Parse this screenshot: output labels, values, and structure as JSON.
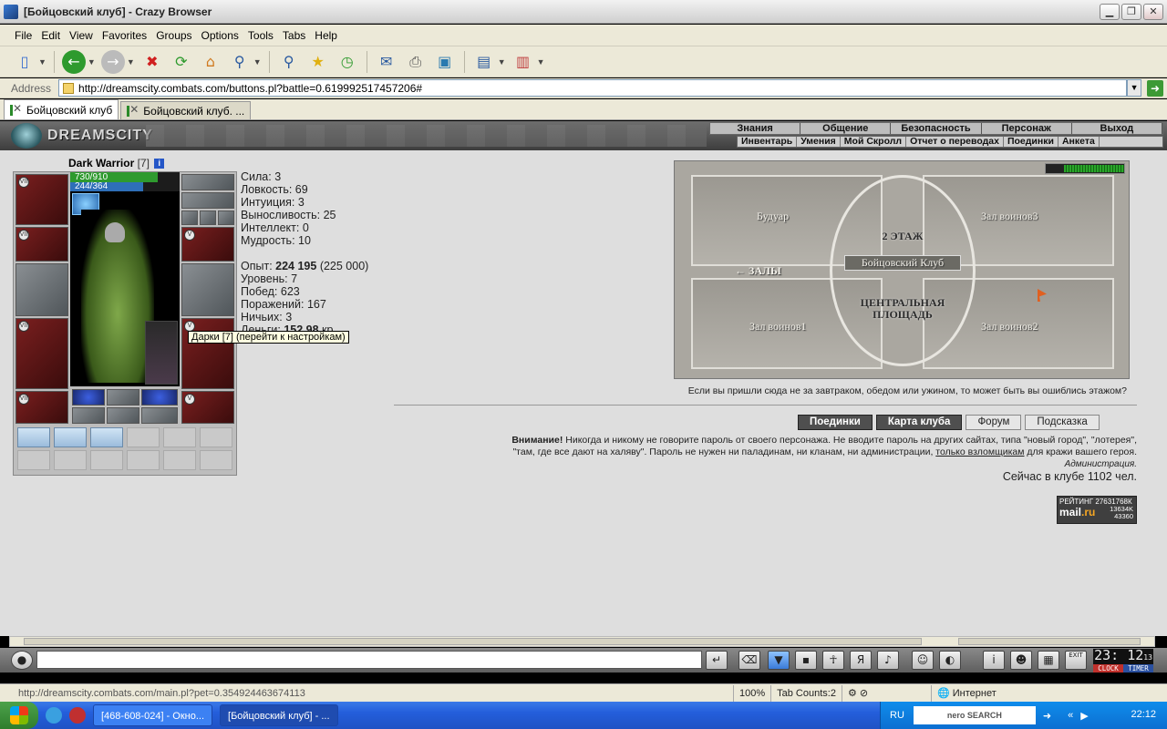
{
  "window": {
    "title": "[Бойцовский клуб] - Crazy Browser",
    "minimize": "▁",
    "maximize": "❐",
    "close": "✕"
  },
  "menu": [
    "File",
    "Edit",
    "View",
    "Favorites",
    "Groups",
    "Options",
    "Tools",
    "Tabs",
    "Help"
  ],
  "toolbar": {
    "icons": [
      "new-page-icon",
      "back-icon",
      "forward-icon",
      "stop-icon",
      "refresh-icon",
      "home-icon",
      "zoom-icon",
      "search-icon",
      "favorites-star-icon",
      "history-icon",
      "mail-icon",
      "print-icon",
      "edit-icon",
      "window-icon",
      "columns-icon"
    ]
  },
  "address": {
    "label": "Address",
    "url": "http://dreamscity.combats.com/buttons.pl?battle=0.619992517457206#"
  },
  "tabs": [
    {
      "label": "Бойцовский клуб",
      "active": true
    },
    {
      "label": "Бойцовский клуб. ...",
      "active": false
    }
  ],
  "game": {
    "logo": "DREAMSCITY",
    "top_nav": [
      "Знания",
      "Общение",
      "Безопасность",
      "Персонаж",
      "Выход"
    ],
    "sub_nav": [
      "Инвентарь",
      "Умения",
      "Мой Скролл",
      "Отчет о переводах",
      "Поединки",
      "Анкета"
    ],
    "character": {
      "name": "Dark Warrior",
      "level": "[7]",
      "hp": "730/910",
      "hp_fraction": 0.8,
      "mana": "244/364",
      "mana_fraction": 0.67,
      "tooltip": "Дарки [7] (перейти к настройкам)",
      "badge": "VII",
      "badge_v": "V"
    },
    "stats": {
      "strength": "Сила: 3",
      "agility": "Ловкость: 69",
      "intuition": "Интуиция: 3",
      "endurance": "Выносливость: 25",
      "intellect": "Интеллект: 0",
      "wisdom": "Мудрость: 10",
      "exp_label": "Опыт: ",
      "exp_value": "224 195",
      "exp_next": " (225 000)",
      "level": "Уровень: 7",
      "wins": "Побед: 623",
      "losses": "Поражений: 167",
      "draws": "Ничьих: 3",
      "money_label": "Деньги: ",
      "money_value": "152.98",
      "money_unit": " кр."
    },
    "map": {
      "boudoir": "Будуар",
      "warriors3": "Зал воинов3",
      "floor2": "2 ЭТАЖ",
      "club": "Бойцовский Клуб",
      "halls": "← ЗАЛЫ",
      "central_line1": "ЦЕНТРАЛЬНАЯ",
      "central_line2": "ПЛОЩАДЬ",
      "warriors1": "Зал воинов1",
      "warriors2": "Зал воинов2",
      "hp_fraction": 0.75
    },
    "map_note": "Если вы пришли сюда не за завтраком, обедом или ужином, то может быть вы ошиблись этажом?",
    "buttons": {
      "fights": "Поединки",
      "club_map": "Карта клуба",
      "forum": "Форум",
      "hint": "Подсказка"
    },
    "warning": {
      "bold": "Внимание!",
      "text1": " Никогда и никому не говорите пароль от своего персонажа. Не вводите пароль на других сайтах, типа \"новый город\", \"лотерея\",",
      "text2": "\"там, где все дают на халяву\". Пароль не нужен ни паладинам, ни кланам, ни администрации, ",
      "link": "только взломщикам",
      "text3": " для кражи вашего героя.",
      "signature": "Администрация."
    },
    "online": "Сейчас в клубе 1102 чел.",
    "rating": {
      "title": "РЕЙТИНГ 27631768К",
      "brand_mail": "mail",
      "brand_ru": ".ru",
      "n1": "13634K",
      "n2": "43360"
    }
  },
  "clock": {
    "time": "23: 12",
    "seconds": "13",
    "label_clock": "CLOCK",
    "label_timer": "TIMER"
  },
  "chat_icons": [
    "enter-icon",
    "eraser-icon",
    "filter-icon",
    "save-icon",
    "fighter-icon",
    "translit-icon",
    "sound-icon",
    "smiley-icon",
    "helmet-icon",
    "info-icon",
    "mask-icon",
    "inventory-icon",
    "exit-icon"
  ],
  "chat_exit": "EXIT",
  "statusbar": {
    "url": "http://dreamscity.combats.com/main.pl?pet=0.354924463674113",
    "zoom": "100%",
    "tab_count": "Tab Counts:2",
    "zone": "Интернет"
  },
  "taskbar": {
    "task1": "[468-608-024] - Окно...",
    "task2": "[Бойцовский клуб] - ...",
    "lang": "RU",
    "search_brand": "nero SEARCH",
    "time": "22:12"
  }
}
